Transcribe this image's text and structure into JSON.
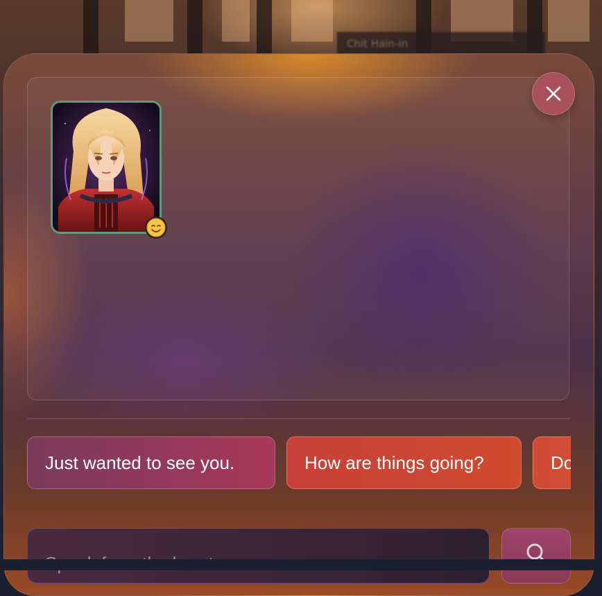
{
  "background": {
    "sign_text": "Chit Hain-in"
  },
  "character": {
    "portrait_icon": "character-portrait",
    "mood_icon": "smiling-face-icon",
    "mood_glyph": "😊",
    "frame_color": "#5f9a7e"
  },
  "controls": {
    "close_icon": "close-icon",
    "send_icon": "search-icon"
  },
  "suggestions": [
    {
      "label": "Just wanted to see you."
    },
    {
      "label": "How are things going?"
    },
    {
      "label": "Do"
    }
  ],
  "input": {
    "placeholder": "Speak from the heart...",
    "value": ""
  },
  "colors": {
    "accent_chip": "#c84038",
    "close_button": "#a8505c",
    "send_button": "#a0446a"
  }
}
